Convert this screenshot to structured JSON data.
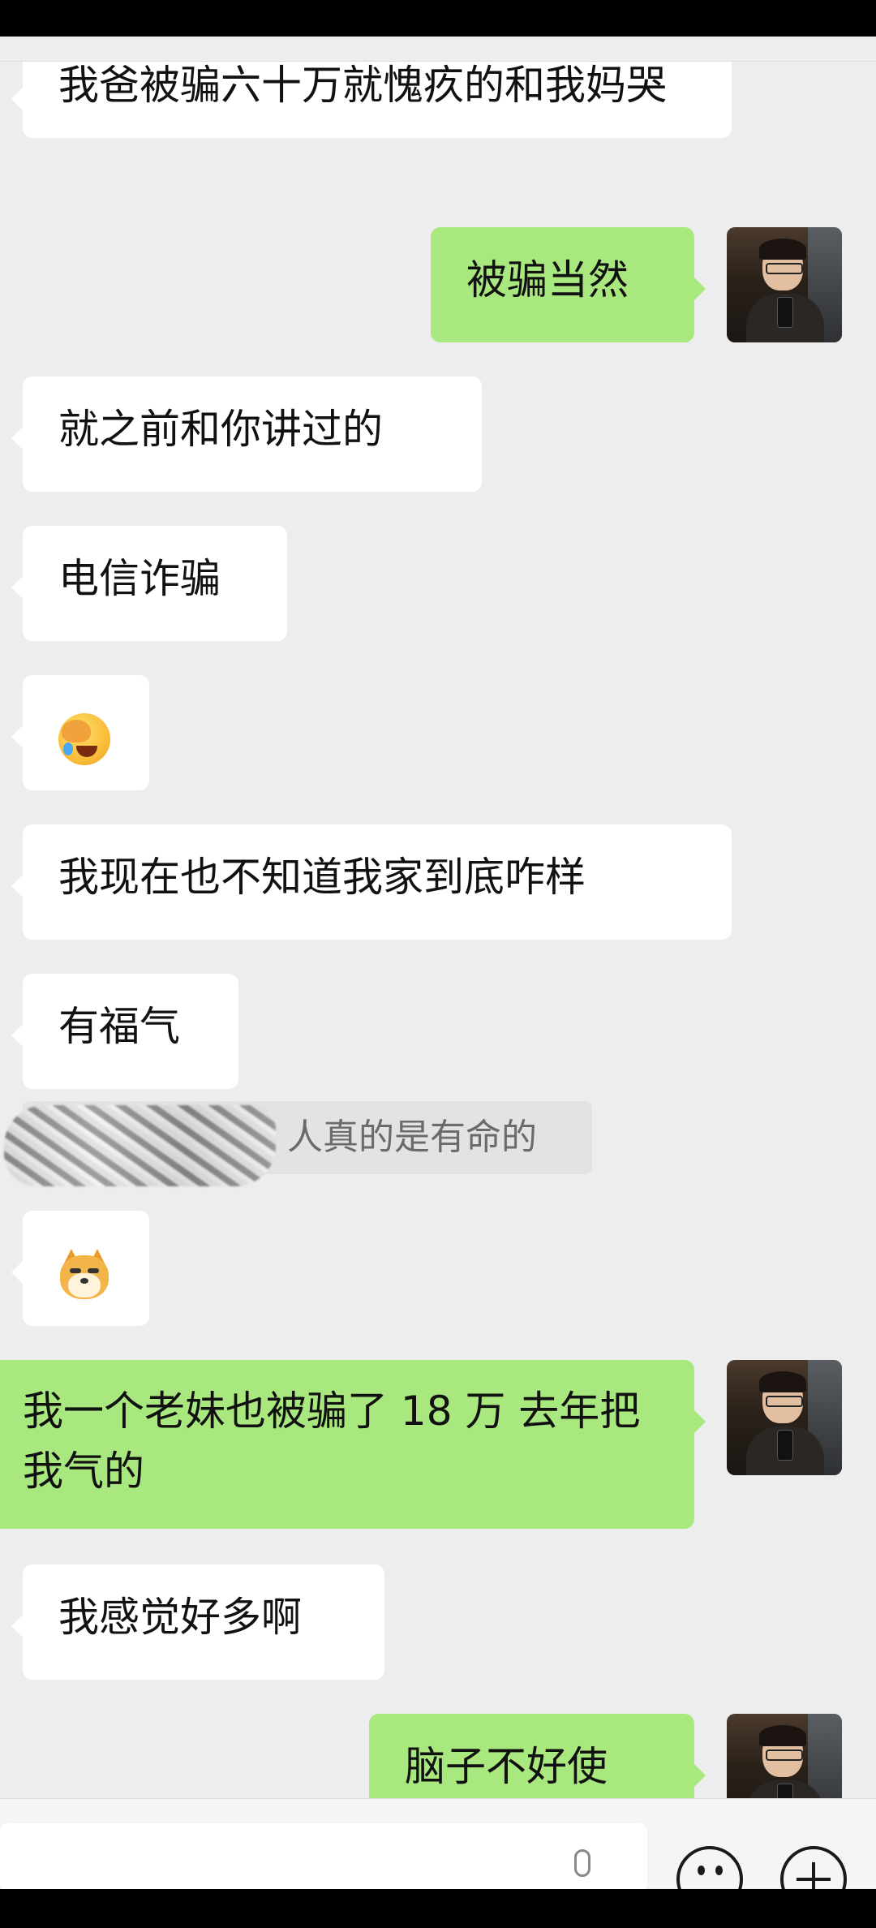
{
  "messages": {
    "m1": "我爸被骗六十万就愧疚的和我妈哭",
    "m2": "被骗当然",
    "m3": "就之前和你讲过的",
    "m4": "电信诈骗",
    "m5_icon": "facepalm-crying-emoji",
    "m6": "我现在也不知道我家到底咋样",
    "m7": "有福气",
    "m7_quote": "人真的是有命的",
    "m8_icon": "doge-emoji",
    "m9": "我一个老妹也被骗了 18 万 去年把我气的",
    "m10": "我感觉好多啊",
    "m11": "脑子不好使"
  },
  "icons": {
    "voice": "microphone-icon",
    "emoji": "emoji-icon",
    "more": "plus-icon"
  },
  "colors": {
    "background": "#ededed",
    "incoming_bubble": "#ffffff",
    "outgoing_bubble": "#a9e87f"
  }
}
